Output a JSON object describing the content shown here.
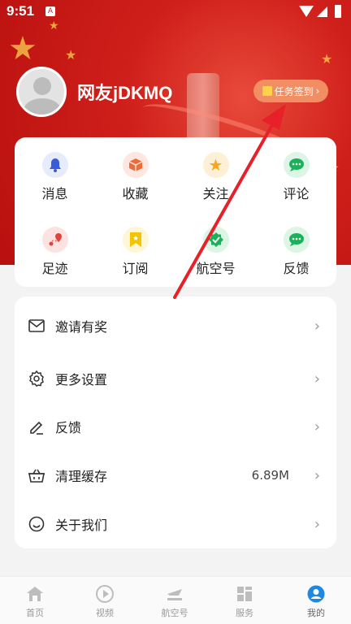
{
  "status_bar": {
    "time": "9:51",
    "app_badge": "A"
  },
  "profile": {
    "username": "网友jDKMQ",
    "signin_label": "任务签到"
  },
  "grid": [
    {
      "label": "消息",
      "icon": "bell-icon",
      "color": "#3b5bd9",
      "bg": "#e6ecfb"
    },
    {
      "label": "收藏",
      "icon": "box-icon",
      "color": "#f06b3a",
      "bg": "#fde7de"
    },
    {
      "label": "关注",
      "icon": "star-icon",
      "color": "#f5a623",
      "bg": "#fdf0d7"
    },
    {
      "label": "评论",
      "icon": "chat-icon",
      "color": "#19b25a",
      "bg": "#dcf5e5"
    },
    {
      "label": "足迹",
      "icon": "pin-route-icon",
      "color": "#e0443a",
      "bg": "#fce3e1"
    },
    {
      "label": "订阅",
      "icon": "bookmark-icon",
      "color": "#f5c400",
      "bg": "#fff6d6"
    },
    {
      "label": "航空号",
      "icon": "shield-check-icon",
      "color": "#19b25a",
      "bg": "#dcf5e5"
    },
    {
      "label": "反馈",
      "icon": "chat-icon",
      "color": "#19b25a",
      "bg": "#dcf5e5"
    }
  ],
  "menu": [
    {
      "label": "邀请有奖",
      "icon": "mail-icon",
      "value": ""
    },
    {
      "label": "更多设置",
      "icon": "gear-icon",
      "value": ""
    },
    {
      "label": "反馈",
      "icon": "pencil-icon",
      "value": ""
    },
    {
      "label": "清理缓存",
      "icon": "basket-icon",
      "value": "6.89M"
    },
    {
      "label": "关于我们",
      "icon": "smile-icon",
      "value": ""
    }
  ],
  "tabs": [
    {
      "label": "首页",
      "icon": "home-icon"
    },
    {
      "label": "视频",
      "icon": "play-icon"
    },
    {
      "label": "航空号",
      "icon": "plane-icon"
    },
    {
      "label": "服务",
      "icon": "grid-icon"
    },
    {
      "label": "我的",
      "icon": "user-icon",
      "active": true
    }
  ],
  "colors": {
    "accent": "#1e88e5",
    "hero_red": "#cf1f1a"
  }
}
